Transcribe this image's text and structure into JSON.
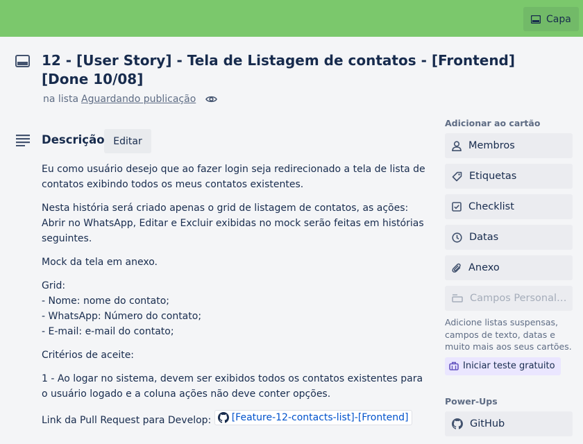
{
  "cover": {
    "button_label": "Capa"
  },
  "card": {
    "title": "12 - [User Story] - Tela de Listagem de contatos - [Frontend] [Done 10/08]",
    "list_prefix": "na lista",
    "list_name": "Aguardando publicação"
  },
  "description": {
    "heading": "Descrição",
    "edit_label": "Editar",
    "paragraphs": {
      "p1": "Eu como usuário desejo que ao fazer login seja redirecionado a tela de lista de contatos exibindo todos os meus contatos existentes.",
      "p2": "Nesta história será criado apenas o grid de listagem de contatos, as ações: Abrir no WhatsApp, Editar e Excluir exibidas no mock serão feitas em histórias seguintes.",
      "p3": "Mock da tela em anexo.",
      "grid_title": "Grid:",
      "grid_1": "- Nome: nome do contato;",
      "grid_2": "- WhatsApp: Número do contato;",
      "grid_3": "- E-mail: e-mail do contato;",
      "criteria_title": "Critérios de aceite:",
      "criteria_1": "1 - Ao logar no sistema, devem ser exibidos todos os contatos existentes para o usuário logado e a coluna ações não deve conter opções.",
      "link_prefix": "Link da Pull Request para Develop:",
      "link_text": "[Feature-12-contacts-list]-[Frontend]"
    }
  },
  "sidebar": {
    "add_heading": "Adicionar ao cartão",
    "buttons": {
      "members": "Membros",
      "labels": "Etiquetas",
      "checklist": "Checklist",
      "dates": "Datas",
      "attachment": "Anexo",
      "custom_fields": "Campos Personal…"
    },
    "note": "Adicione listas suspensas, campos de texto, datas e muito mais aos seus cartões.",
    "trial_label": "Iniciar teste gratuito",
    "powerups_heading": "Power-Ups",
    "github_label": "GitHub"
  }
}
